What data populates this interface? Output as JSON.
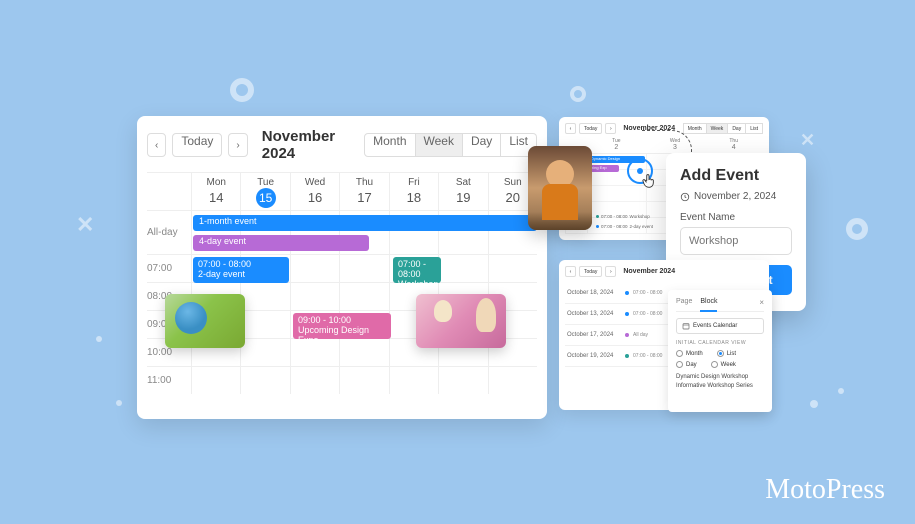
{
  "colors": {
    "blue": "#1a8cff",
    "purple": "#b76ad6",
    "teal": "#2aa198",
    "pink": "#e06aa8"
  },
  "calendar": {
    "today_label": "Today",
    "title": "November 2024",
    "views": {
      "month": "Month",
      "week": "Week",
      "day": "Day",
      "list": "List"
    },
    "active_view": "Week",
    "all_day_label": "All-day",
    "days": [
      {
        "name": "Mon",
        "num": "14"
      },
      {
        "name": "Tue",
        "num": "15",
        "today": true
      },
      {
        "name": "Wed",
        "num": "16"
      },
      {
        "name": "Thu",
        "num": "17"
      },
      {
        "name": "Fri",
        "num": "18"
      },
      {
        "name": "Sat",
        "num": "19"
      },
      {
        "name": "Sun",
        "num": "20"
      }
    ],
    "hours": [
      "07:00",
      "08:00",
      "09:00",
      "10:00",
      "11:00"
    ],
    "allday_events": [
      {
        "label": "1-month event",
        "color": "blue"
      },
      {
        "label": "4-day event",
        "color": "purple"
      }
    ],
    "events": [
      {
        "time": "07:00 - 08:00",
        "title": "2-day event",
        "color": "blue"
      },
      {
        "time": "07:00 - 08:00",
        "title": "Workshop",
        "color": "teal"
      },
      {
        "time": "09:00 - 10:00",
        "title": "Upcoming Design Expo",
        "color": "pink"
      }
    ]
  },
  "mini": {
    "today_label": "Today",
    "title": "November 2024",
    "views": {
      "month": "Month",
      "week": "Week",
      "day": "Day",
      "list": "List"
    },
    "active_view": "Week",
    "days": [
      {
        "name": "Tue",
        "num": "2"
      },
      {
        "name": "Wed",
        "num": "3"
      },
      {
        "name": "Thu",
        "num": "4"
      }
    ],
    "event_bars": [
      {
        "label": "Dynamic Design",
        "color": "blue"
      },
      {
        "label": "ning Exp",
        "color": "purple"
      }
    ],
    "dot_labels": [
      {
        "time": "07:00 - 08:00",
        "title": "Workshop",
        "color": "teal"
      },
      {
        "time": "07:00 - 08:00",
        "title": "2-day event",
        "color": "blue"
      }
    ]
  },
  "popover": {
    "title": "Add Event",
    "date": "November 2, 2024",
    "field_label": "Event Name",
    "placeholder": "Workshop",
    "button": "Create Event"
  },
  "list": {
    "today_label": "Today",
    "title": "November 2024",
    "rows": [
      {
        "date": "October 18, 2024",
        "time": "07:00 - 08:00",
        "color": "blue"
      },
      {
        "date": "October 13, 2024",
        "time": "07:00 - 08:00",
        "color": "blue"
      },
      {
        "date": "October 17, 2024",
        "time": "All day",
        "color": "purple"
      },
      {
        "date": "October 19, 2024",
        "time": "07:00 - 08:00",
        "color": "teal"
      }
    ]
  },
  "block": {
    "tabs": {
      "page": "Page",
      "block": "Block"
    },
    "active_tab": "Block",
    "field": "Events Calendar",
    "section": "INITIAL CALENDAR VIEW",
    "radios": {
      "month": "Month",
      "list": "List",
      "day": "Day",
      "week": "Week"
    },
    "selected": "List",
    "links": [
      "Dynamic Design Workshop",
      "Informative Workshop Series"
    ]
  },
  "logo": "MotoPress"
}
